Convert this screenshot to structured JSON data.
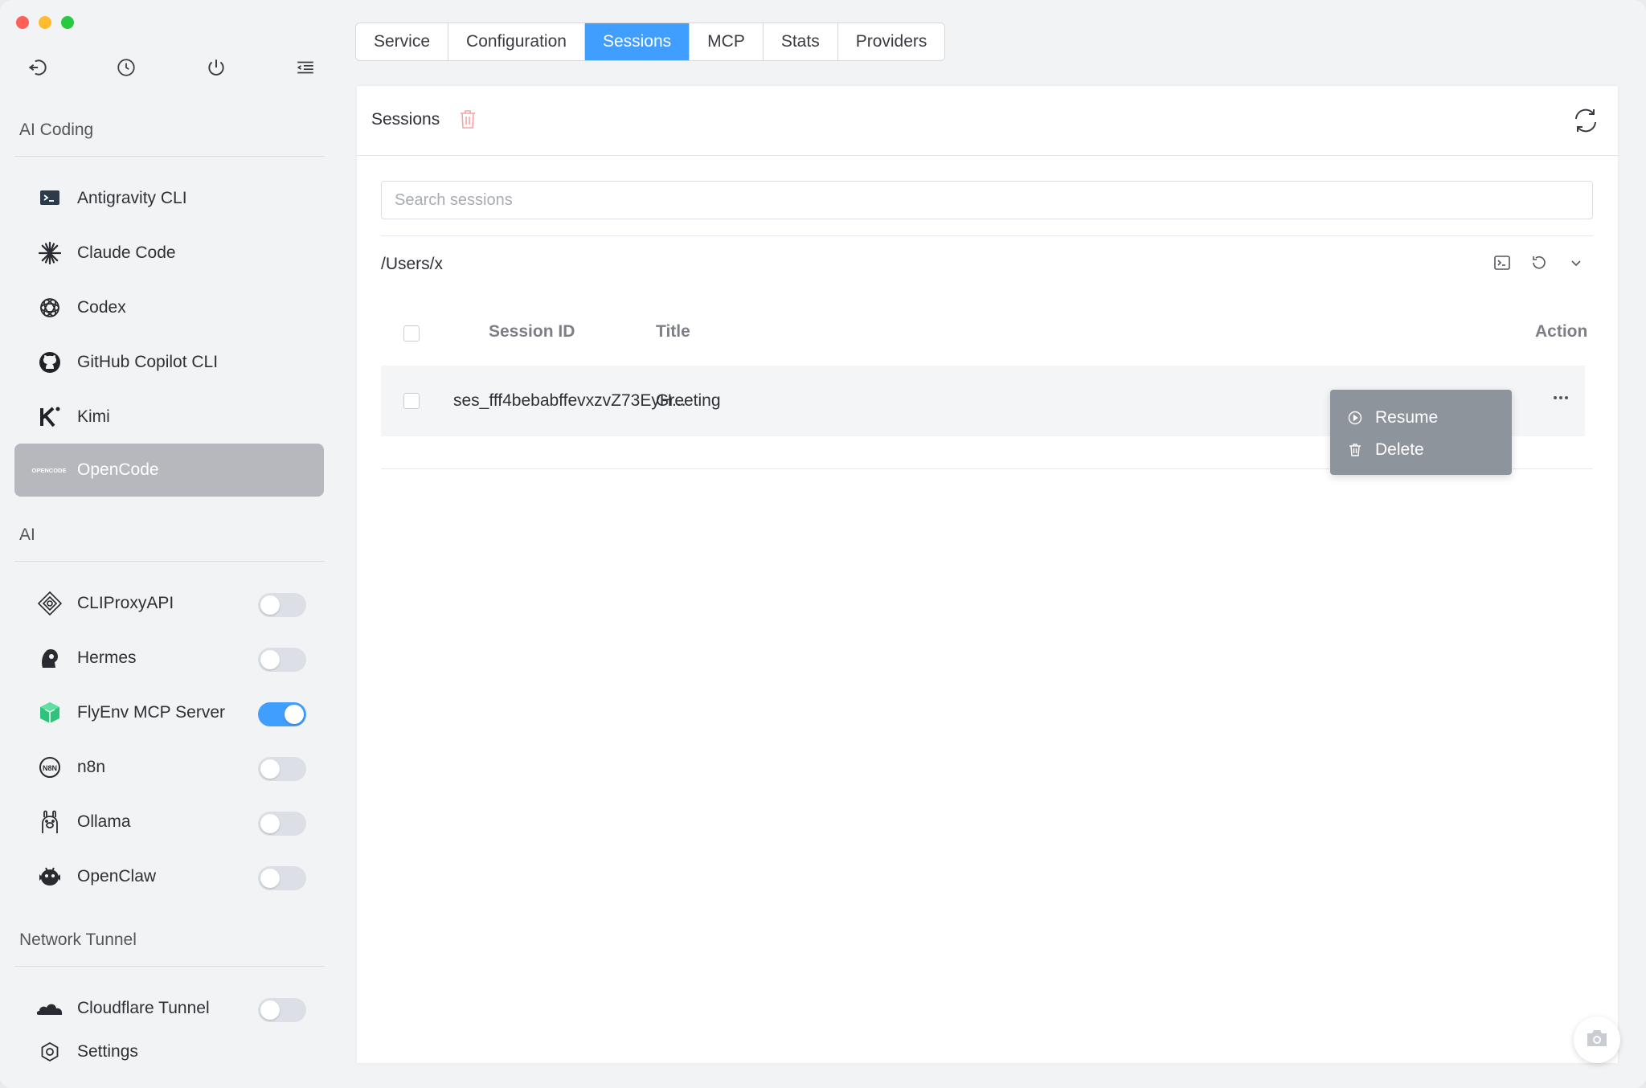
{
  "sidebar": {
    "toolbar_icons": [
      "back-arrow-icon",
      "clock-icon",
      "power-icon",
      "menu-indent-icon"
    ],
    "sections": [
      {
        "title": "AI Coding",
        "items": [
          {
            "label": "Antigravity CLI",
            "icon": "terminal-icon"
          },
          {
            "label": "Claude Code",
            "icon": "claude-sparkle-icon"
          },
          {
            "label": "Codex",
            "icon": "openai-icon"
          },
          {
            "label": "GitHub Copilot CLI",
            "icon": "github-icon"
          },
          {
            "label": "Kimi",
            "icon": "kimi-icon"
          },
          {
            "label": "OpenCode",
            "icon": "opencode-logo-icon",
            "active": true,
            "logo_text": "OPENCODE"
          }
        ]
      },
      {
        "title": "AI",
        "items": [
          {
            "label": "CLIProxyAPI",
            "icon": "cliproxy-icon",
            "toggle": false
          },
          {
            "label": "Hermes",
            "icon": "hermes-icon",
            "toggle": false
          },
          {
            "label": "FlyEnv MCP Server",
            "icon": "flyenv-cube-icon",
            "toggle": true
          },
          {
            "label": "n8n",
            "icon": "n8n-icon",
            "toggle": false
          },
          {
            "label": "Ollama",
            "icon": "ollama-icon",
            "toggle": false
          },
          {
            "label": "OpenClaw",
            "icon": "openclaw-icon",
            "toggle": false
          }
        ]
      },
      {
        "title": "Network Tunnel",
        "items": [
          {
            "label": "Cloudflare Tunnel",
            "icon": "cloud-icon",
            "toggle": false
          }
        ]
      }
    ],
    "settings_label": "Settings"
  },
  "tabs": [
    "Service",
    "Configuration",
    "Sessions",
    "MCP",
    "Stats",
    "Providers"
  ],
  "active_tab": "Sessions",
  "sessions": {
    "title": "Sessions",
    "search_placeholder": "Search sessions",
    "path": "/Users/x",
    "columns": {
      "session_id": "Session ID",
      "title": "Title",
      "action": "Action"
    },
    "rows": [
      {
        "session_id": "ses_fff4bebabffevxzvZ73EyH...",
        "title": "Greeting"
      }
    ],
    "context_menu": {
      "resume": "Resume",
      "delete": "Delete"
    }
  },
  "colors": {
    "accent": "#409eff",
    "active_item": "#b6b8bd",
    "danger_light": "#f5a3a3"
  }
}
